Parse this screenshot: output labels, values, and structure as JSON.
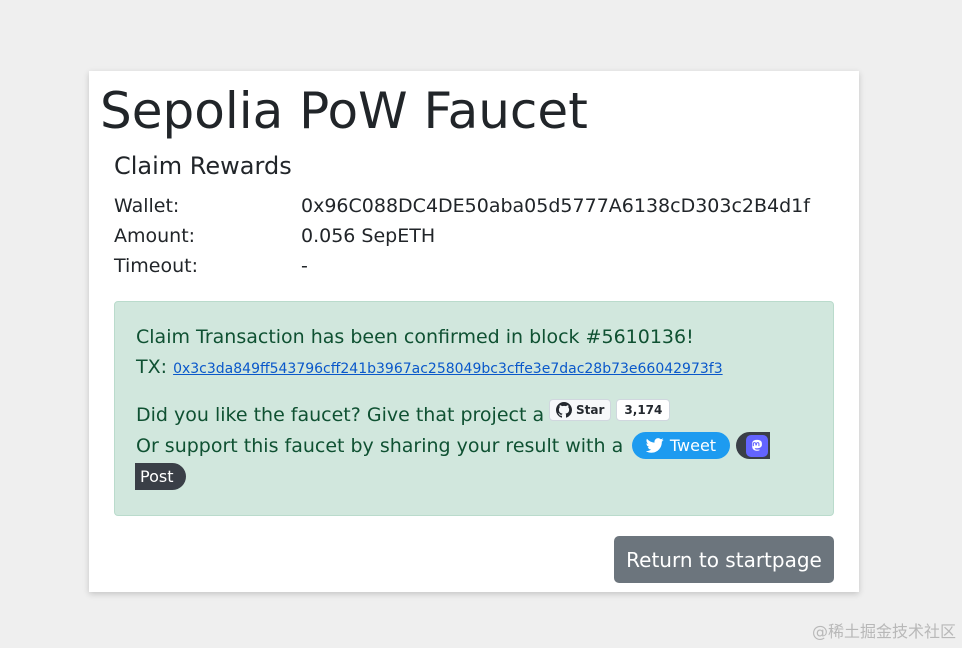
{
  "title": "Sepolia PoW Faucet",
  "subtitle": "Claim Rewards",
  "info": {
    "wallet_label": "Wallet:",
    "wallet_value": "0x96C088DC4DE50aba05d5777A6138cD303c2B4d1f",
    "amount_label": "Amount:",
    "amount_value": "0.056 SepETH",
    "timeout_label": "Timeout:",
    "timeout_value": "-"
  },
  "alert": {
    "confirmed_text": "Claim Transaction has been confirmed in block #5610136!",
    "tx_label": "TX:",
    "tx_hash": "0x3c3da849ff543796cff241b3967ac258049bc3cffe3e7dac28b73e66042973f3",
    "like_text": "Did you like the faucet? Give that project a",
    "support_text": "Or support this faucet by sharing your result with a"
  },
  "github": {
    "star_label": "Star",
    "star_count": "3,174",
    "icon": "github-icon"
  },
  "share": {
    "tweet_label": "Tweet",
    "tweet_icon": "twitter-bird-icon",
    "mastodon_icon": "mastodon-icon",
    "post_label": "Post"
  },
  "return_button_label": "Return to startpage",
  "watermark": "@稀土掘金技术社区",
  "colors": {
    "alert_bg": "#d1e7dd",
    "alert_text": "#0f5132",
    "link": "#0a58ca",
    "tweet_bg": "#1d9bf0",
    "mastodon": "#6364ff",
    "secondary_button": "#6c757d"
  }
}
